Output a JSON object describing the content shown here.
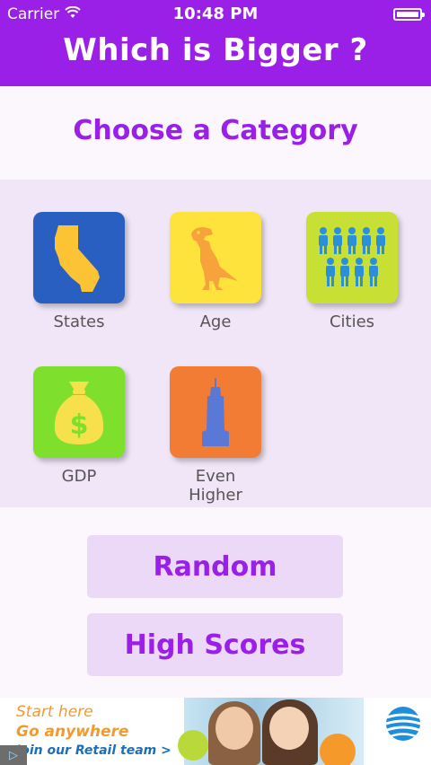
{
  "status": {
    "carrier": "Carrier",
    "time": "10:48 PM"
  },
  "header": {
    "title": "Which is Bigger ?"
  },
  "main": {
    "heading": "Choose a Category",
    "categories": [
      {
        "label": "States",
        "icon": "california-state-icon",
        "color": "#2a5fc2"
      },
      {
        "label": "Age",
        "icon": "dinosaur-icon",
        "color": "#fee33d"
      },
      {
        "label": "Cities",
        "icon": "people-group-icon",
        "color": "#c8e033"
      },
      {
        "label": "GDP",
        "icon": "money-bag-icon",
        "color": "#7ee02d"
      },
      {
        "label": "Even Higher",
        "icon": "skyscraper-icon",
        "color": "#f27c34"
      }
    ],
    "buttons": {
      "random": "Random",
      "high_scores": "High Scores"
    }
  },
  "ad": {
    "line1": "Start here",
    "line2": "Go anywhere",
    "line3": "Join our Retail team >"
  },
  "colors": {
    "accent": "#9a20e8",
    "button_bg": "#ecd9f8",
    "panel_bg": "#f0e6f7"
  }
}
